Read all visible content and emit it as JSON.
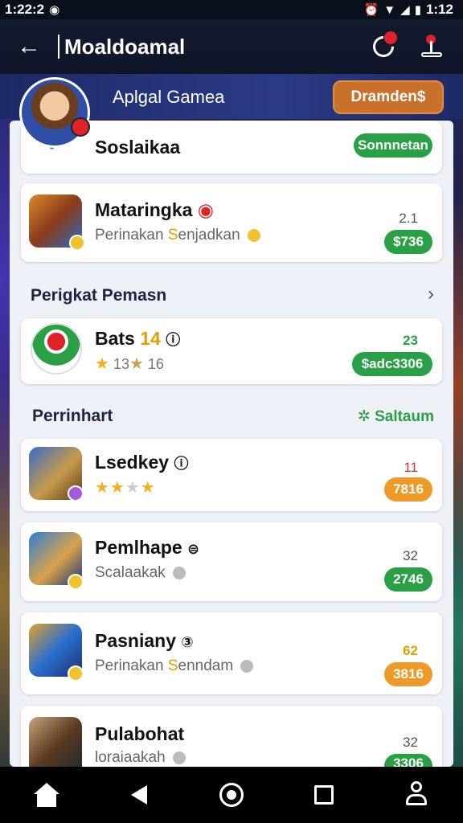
{
  "status_bar": {
    "time_left": "1:22:2",
    "time_right": "1:12"
  },
  "app_bar": {
    "title": "Moaldoamal"
  },
  "banner": {
    "title": "Aplgal Gamea",
    "button": "Dramden$"
  },
  "featured": {
    "name": "Soslaikaa",
    "button": "Sonnnetan"
  },
  "top_game": {
    "name": "Mataringka",
    "sub_prefix": "Perinakan",
    "sub_accent": "S",
    "sub_suffix": "enjadkan",
    "count": "2.1",
    "pill": "$736"
  },
  "section1": {
    "title": "Perigkat Pemasn"
  },
  "section1_game": {
    "name": "Bats",
    "name_accent": "14",
    "rating": "13",
    "rating_extra": "16",
    "count": "23",
    "pill": "$adc3306"
  },
  "section2": {
    "title": "Perrinhart",
    "link": "Saltaum"
  },
  "games": [
    {
      "name": "Lsedkey",
      "count": "11",
      "pill": "7816",
      "pill_color": "orange"
    },
    {
      "name": "Pemlhape",
      "sub": "Scalaakak",
      "count": "32",
      "pill": "2746",
      "pill_color": "green"
    },
    {
      "name": "Pasniany",
      "sub_prefix": "Perinakan",
      "sub_accent": "S",
      "sub_suffix": "enndam",
      "count": "62",
      "pill": "3816",
      "pill_color": "orange"
    },
    {
      "name": "Pulabohat",
      "sub": "loraiaakah",
      "count": "32",
      "pill": "3306",
      "pill_color": "green"
    }
  ],
  "colors": {
    "green": "#2aa046",
    "orange": "#ee9a29",
    "banner_button": "#c9702a"
  }
}
